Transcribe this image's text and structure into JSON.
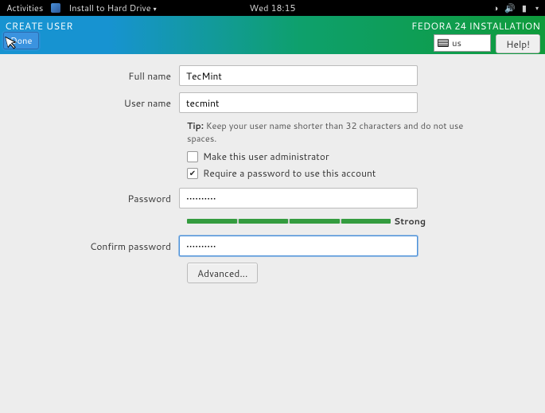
{
  "topbar": {
    "activities": "Activities",
    "app_name": "Install to Hard Drive",
    "clock": "Wed 18:15"
  },
  "header": {
    "title": "CREATE USER",
    "install_title": "FEDORA 24 INSTALLATION",
    "keyboard_layout": "us",
    "help_label": "Help!",
    "done_label": "Done"
  },
  "form": {
    "full_name_label": "Full name",
    "full_name_value": "TecMint",
    "user_name_label": "User name",
    "user_name_value": "tecmint",
    "tip_prefix": "Tip:",
    "tip_text": " Keep your user name shorter than 32 characters and do not use spaces.",
    "admin_label": "Make this user administrator",
    "admin_checked": false,
    "require_pw_label": "Require a password to use this account",
    "require_pw_checked": true,
    "password_label": "Password",
    "password_value": "••••••••••",
    "confirm_label": "Confirm password",
    "confirm_value": "••••••••••",
    "strength_label": "Strong",
    "strength_segments": 4,
    "strength_filled": 4,
    "advanced_label": "Advanced..."
  }
}
